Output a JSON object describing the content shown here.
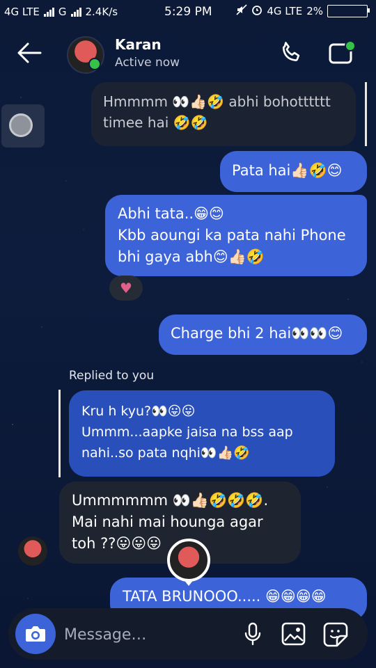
{
  "status_bar": {
    "network1": "4G LTE",
    "network2": "G",
    "speed": "2.4K/s",
    "time": "5:29 PM",
    "network3": "4G LTE",
    "battery": "2%"
  },
  "header": {
    "name": "Karan",
    "status": "Active now"
  },
  "messages": [
    {
      "side": "in",
      "text": "Hmmmm 👀👍🏻🤣 abhi bohotttttt\ntimee hai 🤣🤣"
    },
    {
      "side": "out",
      "text": "Pata hai👍🏻🤣😊"
    },
    {
      "side": "out",
      "text": "Abhi tata..😁😊\nKbb aoungi ka pata nahi Phone\nbhi gaya abh😊👍🏻🤣"
    },
    {
      "side": "out",
      "text": "Charge bhi 2 hai👀👀😊"
    },
    {
      "side": "in",
      "text": "Ummmmmm 👀👍🏻🤣🤣🤣.\nMai nahi mai hounga agar\ntoh ??😛😛😛"
    },
    {
      "side": "out",
      "text": "TATA BRUNOOO..... 😁😁😁😁"
    }
  ],
  "reaction": "♥",
  "reply": {
    "label": "Replied to you",
    "text": "Kru h kyu?👀😛😛\nUmmm...aapke jaisa na bss aap\nnahi..so pata nqhi👀👍🏻🤣"
  },
  "composer": {
    "placeholder": "Message…"
  },
  "colors": {
    "accent": "#3d63d8",
    "incoming": "#1f2530",
    "online": "#35c248"
  }
}
